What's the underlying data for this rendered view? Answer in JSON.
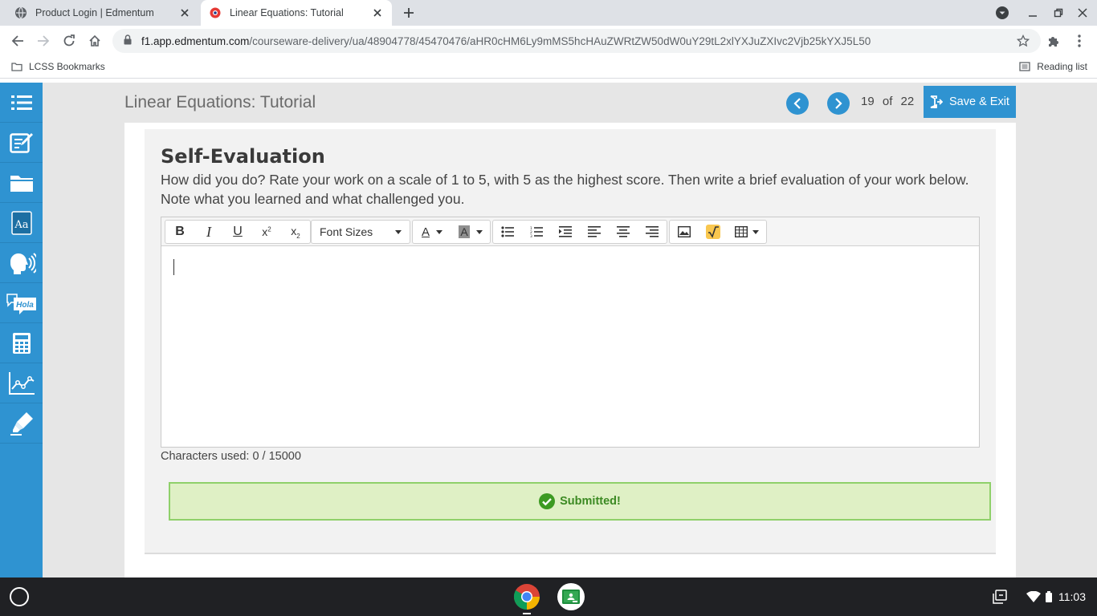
{
  "browser": {
    "tabs": [
      {
        "title": "Product Login | Edmentum",
        "active": false
      },
      {
        "title": "Linear Equations: Tutorial",
        "active": true
      }
    ],
    "url_host": "f1.app.edmentum.com",
    "url_path": "/courseware-delivery/ua/48904778/45470476/aHR0cHM6Ly9mMS5hcHAuZWRtZW50dW0uY29tL2xlYXJuZXIvc2Vjb25kYXJ5L50",
    "bookmark": "LCSS Bookmarks",
    "reading_list": "Reading list"
  },
  "sidebar": {
    "items": [
      "menu-list-icon",
      "notes-edit-icon",
      "folder-icon",
      "dictionary-icon",
      "text-to-speech-icon",
      "translate-hola-icon",
      "calculator-icon",
      "graph-icon",
      "highlighter-icon"
    ],
    "color": "#2f93d1"
  },
  "header": {
    "lesson_title": "Linear Equations: Tutorial",
    "page_current": "19",
    "page_of": "of",
    "page_total": "22",
    "save_exit": "Save & Exit"
  },
  "activity": {
    "title": "Self-Evaluation",
    "prompt": "How did you do? Rate your work on a scale of 1 to 5, with 5 as the highest score. Then write a brief evaluation of your work below. Note what you learned and what challenged you.",
    "editor": {
      "font_sizes_label": "Font Sizes",
      "content": ""
    },
    "char_count": "Characters used: 0 / 15000",
    "status": "Submitted!"
  },
  "shelf": {
    "time": "11:03"
  }
}
